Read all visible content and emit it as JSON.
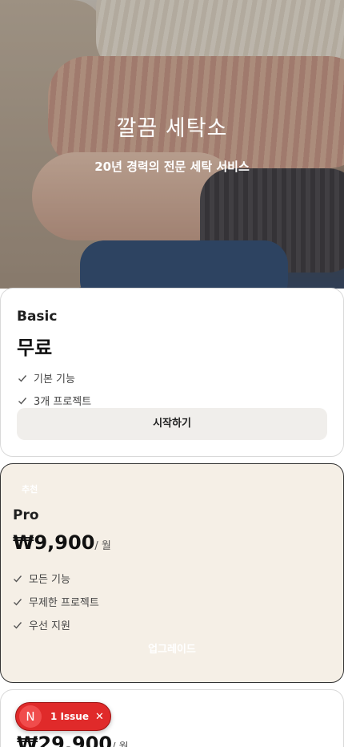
{
  "hero": {
    "title": "깔끔 세탁소",
    "subtitle": "20년 경력의 전문 세탁 서비스"
  },
  "plans": [
    {
      "name": "Basic",
      "price": "무료",
      "features": [
        "기본 기능",
        "3개 프로젝트"
      ],
      "button": "시작하기"
    },
    {
      "badge": "추천",
      "name": "Pro",
      "price": "₩9,900",
      "per": "/ 월",
      "features": [
        "모든 기능",
        "무제한 프로젝트",
        "우선 지원"
      ],
      "button": "업그레이드"
    },
    {
      "price": "₩29,900",
      "per": "/ 월"
    }
  ],
  "issue": {
    "avatar": "N",
    "label": "1 Issue",
    "close": "✕"
  },
  "colors": {
    "pro_bg": "#f5efe6",
    "issue_red": "#e02a2a",
    "button_bg": "#f0eeeb"
  },
  "icons": [
    "check-icon",
    "close-icon"
  ]
}
